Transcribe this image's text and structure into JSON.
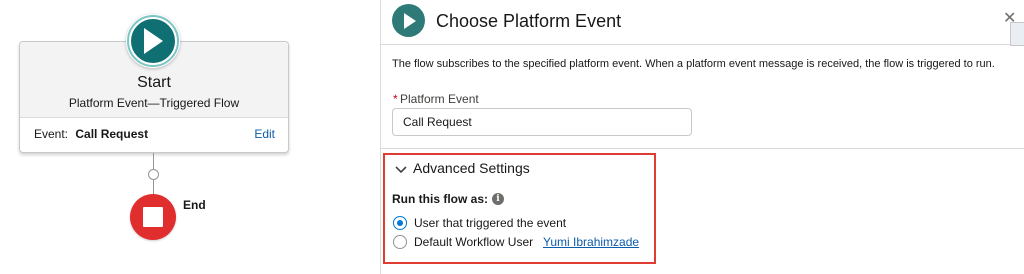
{
  "canvas": {
    "start": {
      "title": "Start",
      "subtitle": "Platform Event—Triggered Flow",
      "event_label": "Event:",
      "event_value": "Call Request",
      "edit_label": "Edit"
    },
    "end": {
      "label": "End"
    },
    "colors": {
      "start_teal": "#0f6f72",
      "end_red": "#e02d2d"
    }
  },
  "panel": {
    "title": "Choose Platform Event",
    "close_icon": "close-icon",
    "description": "The flow subscribes to the specified platform event. When a platform event message is received, the flow is triggered to run.",
    "platform_event": {
      "required_marker": "*",
      "label": "Platform Event",
      "value": "Call Request"
    },
    "advanced": {
      "title": "Advanced Settings",
      "expanded": true,
      "run_as_label": "Run this flow as:",
      "options": [
        {
          "label": "User that triggered the event",
          "selected": true
        },
        {
          "label": "Default Workflow User",
          "selected": false
        }
      ],
      "default_user_link": "Yumi Ibrahimzade"
    },
    "colors": {
      "highlight_box": "#e03c31",
      "link": "#0b5cab",
      "radio_selected": "#0176d3"
    }
  }
}
